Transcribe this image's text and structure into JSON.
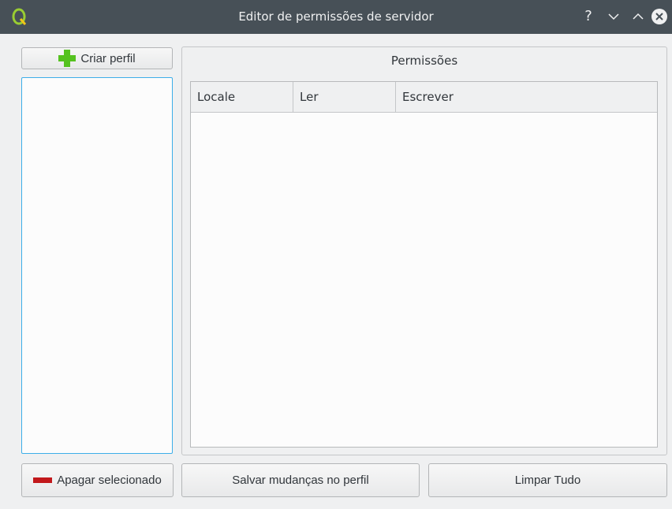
{
  "window": {
    "title": "Editor de permissões de servidor",
    "controls": {
      "help": "?",
      "minimize": "⌄",
      "maximize": "⌃",
      "close": "✕"
    }
  },
  "sidebar": {
    "create_label": "Criar perfil",
    "delete_label": "Apagar selecionado",
    "profiles": []
  },
  "permissions": {
    "title": "Permissões",
    "columns": [
      "Locale",
      "Ler",
      "Escrever"
    ],
    "rows": []
  },
  "footer": {
    "save_label": "Salvar mudanças no perfil",
    "clear_label": "Limpar Tudo"
  },
  "colors": {
    "titlebar": "#475057",
    "accent": "#3daee9",
    "add": "#55c21f",
    "remove": "#c2181b"
  }
}
